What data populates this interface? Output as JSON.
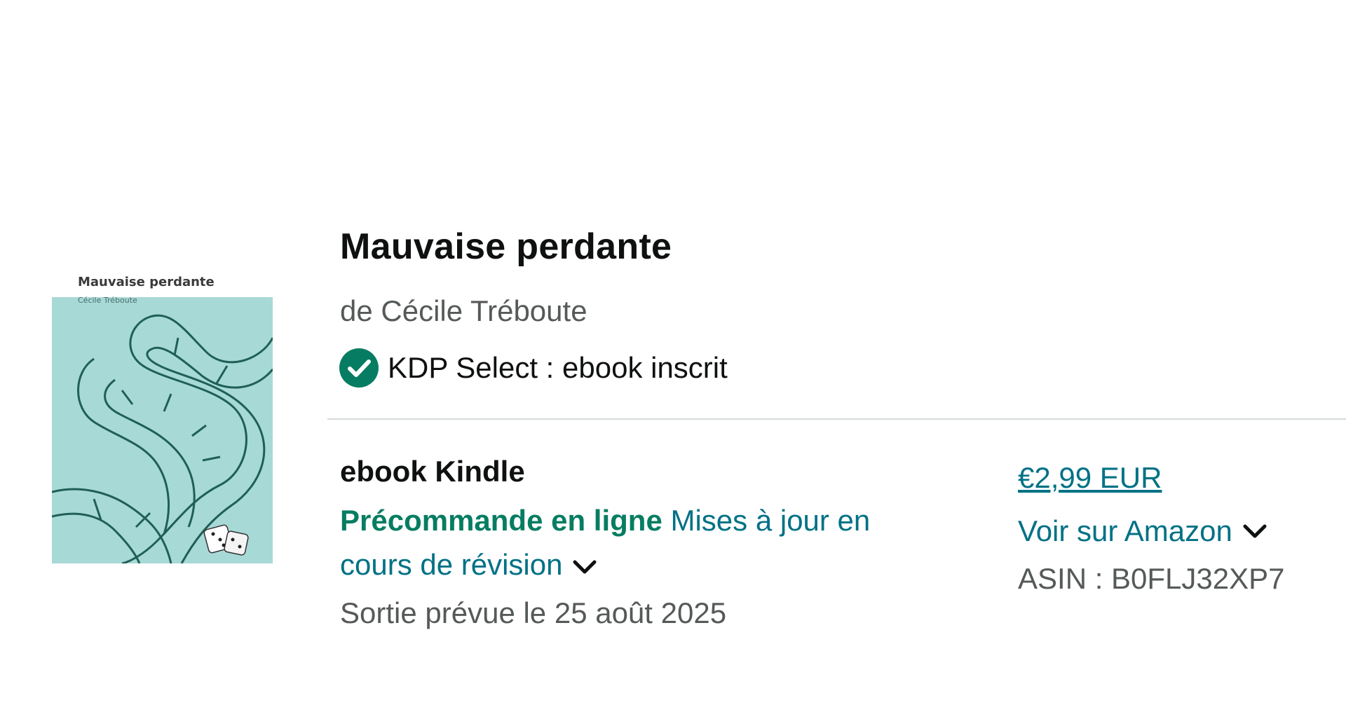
{
  "book": {
    "title": "Mauvaise perdante",
    "author": "de Cécile Tréboute",
    "kdp_status": "KDP Select : ebook inscrit",
    "cover": {
      "title": "Mauvaise perdante",
      "author": "Cécile Tréboute",
      "background_color": "#a7d9d7",
      "line_color": "#1f5f56"
    }
  },
  "edition": {
    "format": "ebook Kindle",
    "status_live": "Précommande en ligne",
    "status_update": "Mises à jour en cours de révision",
    "release": "Sortie prévue le 25 août 2025",
    "price": "€2,99 EUR",
    "amazon_link": "Voir sur Amazon",
    "asin": "ASIN : B0FLJ32XP7"
  },
  "colors": {
    "link": "#007185",
    "success": "#067d62",
    "text": "#0f1111",
    "muted": "#565959",
    "divider": "#d5d9d9"
  },
  "icons": {
    "kdp": "check-circle-icon",
    "expand": "chevron-down-icon"
  }
}
